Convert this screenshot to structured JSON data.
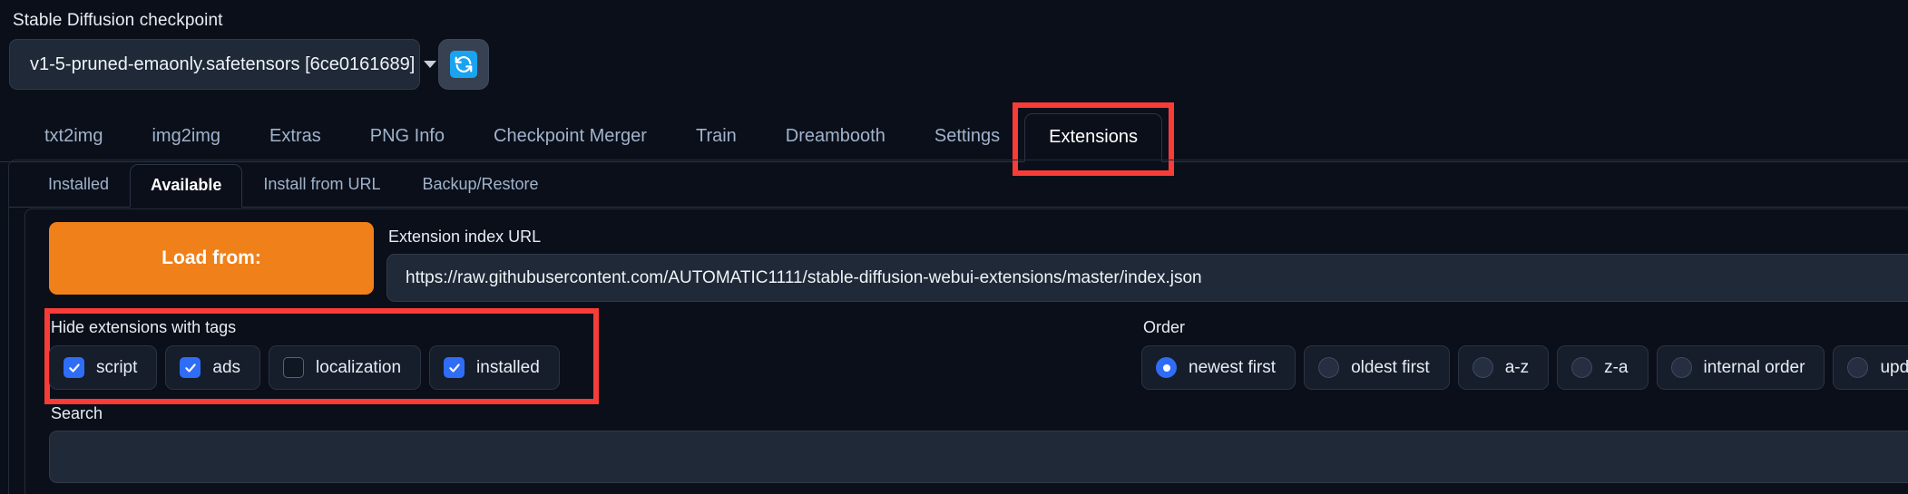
{
  "checkpoint": {
    "label": "Stable Diffusion checkpoint",
    "value": "v1-5-pruned-emaonly.safetensors [6ce0161689]",
    "refresh_icon": "refresh-icon",
    "caret_icon": "chevron-down-icon"
  },
  "main_tabs": [
    {
      "label": "txt2img",
      "active": false
    },
    {
      "label": "img2img",
      "active": false
    },
    {
      "label": "Extras",
      "active": false
    },
    {
      "label": "PNG Info",
      "active": false
    },
    {
      "label": "Checkpoint Merger",
      "active": false
    },
    {
      "label": "Train",
      "active": false
    },
    {
      "label": "Dreambooth",
      "active": false
    },
    {
      "label": "Settings",
      "active": false
    },
    {
      "label": "Extensions",
      "active": true
    }
  ],
  "sub_tabs": [
    {
      "label": "Installed",
      "active": false
    },
    {
      "label": "Available",
      "active": true
    },
    {
      "label": "Install from URL",
      "active": false
    },
    {
      "label": "Backup/Restore",
      "active": false
    }
  ],
  "load_from": {
    "label": "Load from:"
  },
  "extension_index": {
    "label": "Extension index URL",
    "value": "https://raw.githubusercontent.com/AUTOMATIC1111/stable-diffusion-webui-extensions/master/index.json"
  },
  "hide_tags": {
    "label": "Hide extensions with tags",
    "options": [
      {
        "label": "script",
        "checked": true
      },
      {
        "label": "ads",
        "checked": true
      },
      {
        "label": "localization",
        "checked": false
      },
      {
        "label": "installed",
        "checked": true
      }
    ]
  },
  "order": {
    "label": "Order",
    "options": [
      {
        "label": "newest first",
        "selected": true
      },
      {
        "label": "oldest first",
        "selected": false
      },
      {
        "label": "a-z",
        "selected": false
      },
      {
        "label": "z-a",
        "selected": false
      },
      {
        "label": "internal order",
        "selected": false
      },
      {
        "label": "update time",
        "selected": false
      }
    ]
  },
  "search": {
    "label": "Search",
    "value": "",
    "placeholder": ""
  },
  "annotations": {
    "highlight_color": "#f83c38",
    "boxes": [
      {
        "target": "Extensions",
        "name": "extensions-tab-highlight"
      },
      {
        "target": "Hide extensions with tags",
        "name": "hide-tags-highlight"
      }
    ]
  },
  "colors": {
    "background": "#0b0f19",
    "accent_orange": "#f0811a",
    "accent_blue": "#2f6df6",
    "refresh_blue": "#1aa3f0",
    "highlight_red": "#f83c38"
  }
}
